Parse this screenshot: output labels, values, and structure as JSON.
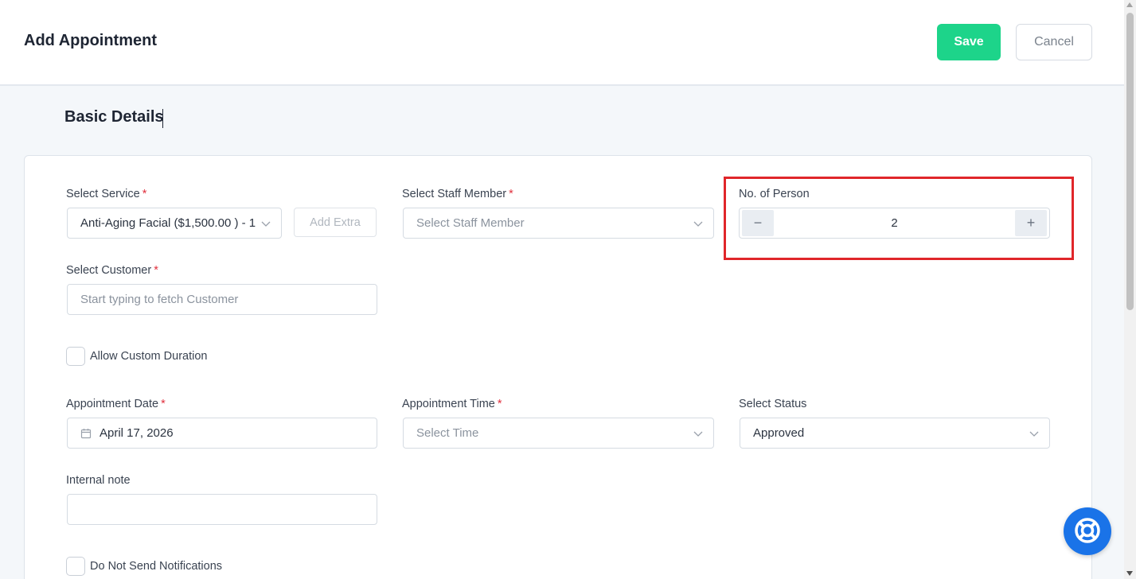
{
  "header": {
    "title": "Add Appointment",
    "save_label": "Save",
    "cancel_label": "Cancel"
  },
  "section": {
    "title": "Basic Details"
  },
  "form": {
    "service": {
      "label": "Select Service",
      "required": "*",
      "value": "Anti-Aging Facial ($1,500.00 ) - 1",
      "add_extra_label": "Add Extra"
    },
    "staff": {
      "label": "Select Staff Member",
      "required": "*",
      "placeholder": "Select Staff Member"
    },
    "persons": {
      "label": "No. of Person",
      "value": "2",
      "minus": "−",
      "plus": "+"
    },
    "customer": {
      "label": "Select Customer",
      "required": "*",
      "placeholder": "Start typing to fetch Customer"
    },
    "custom_duration": {
      "label": "Allow Custom Duration",
      "checked": false
    },
    "date": {
      "label": "Appointment Date",
      "required": "*",
      "value": "April 17, 2026"
    },
    "time": {
      "label": "Appointment Time",
      "required": "*",
      "placeholder": "Select Time"
    },
    "status": {
      "label": "Select Status",
      "value": "Approved"
    },
    "note": {
      "label": "Internal note",
      "value": ""
    },
    "no_notifications": {
      "label": "Do Not Send Notifications",
      "checked": false
    }
  },
  "colors": {
    "save": "#1dd48a",
    "required": "#e0303d",
    "highlight": "#e0262a",
    "help": "#1a73e8"
  },
  "icons": [
    "chevron-down-icon",
    "calendar-icon",
    "lifebuoy-icon",
    "minus-icon",
    "plus-icon"
  ]
}
